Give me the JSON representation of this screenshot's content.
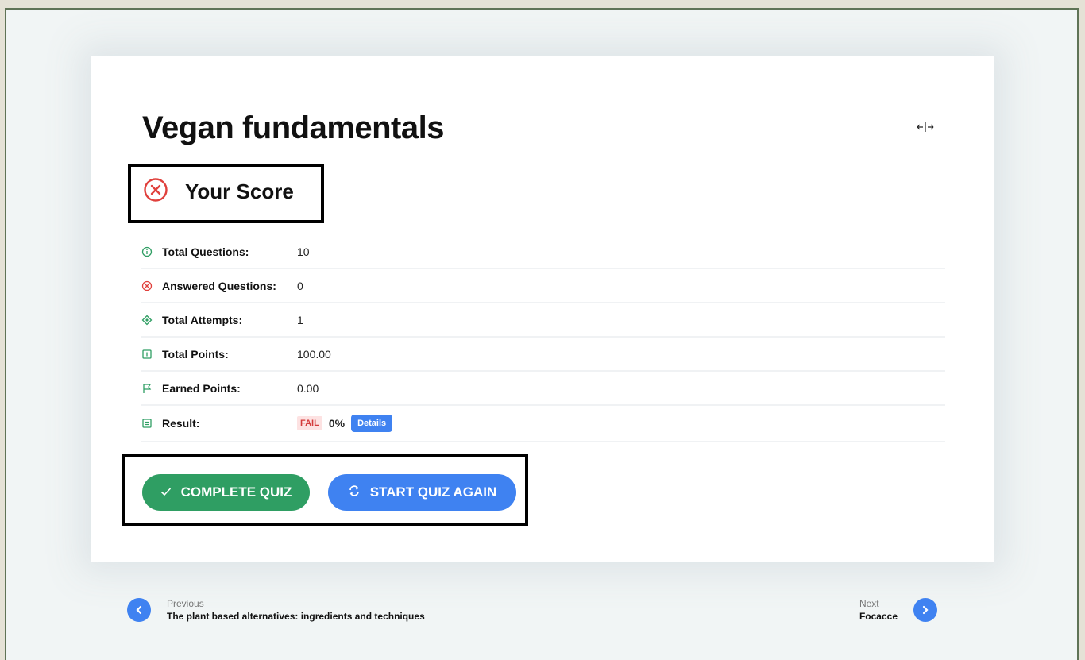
{
  "quiz": {
    "title": "Vegan fundamentals",
    "score_heading": "Your Score",
    "rows": [
      {
        "label": "Total Questions:",
        "value": "10",
        "icon": "info-circle-icon"
      },
      {
        "label": "Answered Questions:",
        "value": "0",
        "icon": "x-circle-icon"
      },
      {
        "label": "Total Attempts:",
        "value": "1",
        "icon": "target-icon"
      },
      {
        "label": "Total Points:",
        "value": "100.00",
        "icon": "points-icon"
      },
      {
        "label": "Earned Points:",
        "value": "0.00",
        "icon": "flag-icon"
      },
      {
        "label": "Result:",
        "icon": "result-icon"
      }
    ],
    "result": {
      "status": "FAIL",
      "percent": "0%",
      "details_label": "Details"
    },
    "buttons": {
      "complete_label": "COMPLETE QUIZ",
      "again_label": "START QUIZ AGAIN"
    }
  },
  "navigation": {
    "previous_label": "Previous",
    "previous_title": "The plant based alternatives: ingredients and techniques",
    "next_label": "Next",
    "next_title": "Focacce"
  },
  "colors": {
    "green": "#2f9e63",
    "blue": "#3f82f1",
    "red": "#e0403c"
  }
}
